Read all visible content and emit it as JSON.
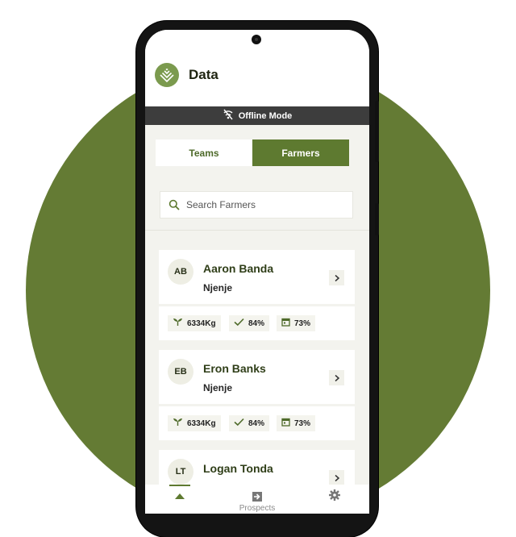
{
  "header": {
    "title": "Data"
  },
  "offline": {
    "label": "Offline Mode"
  },
  "tabs": [
    {
      "label": "Teams",
      "active": false
    },
    {
      "label": "Farmers",
      "active": true
    }
  ],
  "search": {
    "placeholder": "Search Farmers"
  },
  "farmers": [
    {
      "initials": "AB",
      "name": "Aaron Banda",
      "location": "Njenje",
      "yield": "6334Kg",
      "check": "84%",
      "calendar": "73%"
    },
    {
      "initials": "EB",
      "name": "Eron Banks",
      "location": "Njenje",
      "yield": "6334Kg",
      "check": "84%",
      "calendar": "73%"
    },
    {
      "initials": "LT",
      "name": "Logan Tonda"
    }
  ],
  "bottom_nav": [
    {
      "icon": "home-icon",
      "label": ""
    },
    {
      "icon": "arrow-in-icon",
      "label": "Prospects"
    },
    {
      "icon": "gear-icon",
      "label": ""
    }
  ],
  "colors": {
    "brand_green": "#5e7a30",
    "circle_green": "#647b34",
    "offline_bar": "#3d3d3d"
  }
}
